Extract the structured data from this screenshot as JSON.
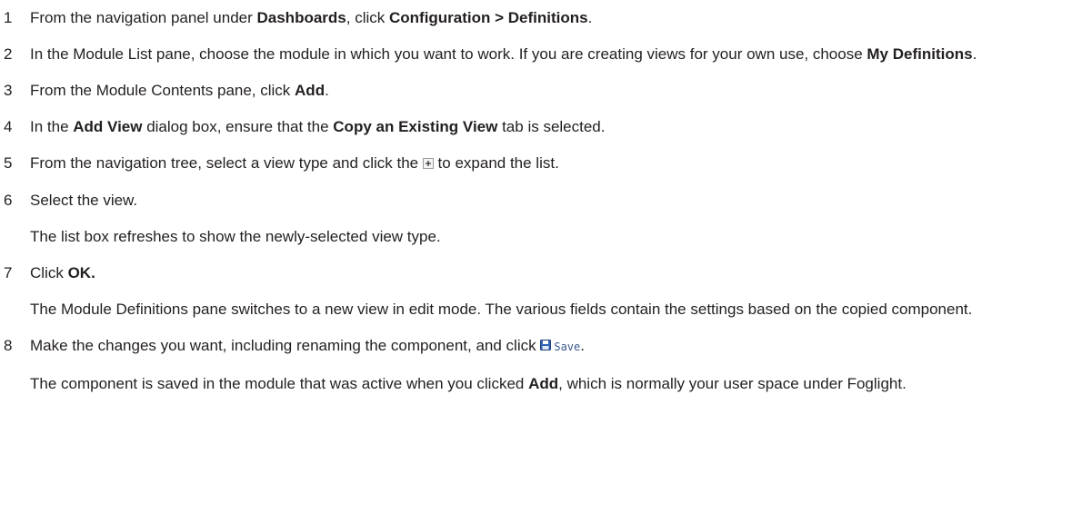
{
  "steps": [
    {
      "num": "1",
      "parts": [
        {
          "t": "From the navigation panel under "
        },
        {
          "t": "Dashboards",
          "b": true
        },
        {
          "t": ", click "
        },
        {
          "t": "Configuration > Definitions",
          "b": true
        },
        {
          "t": "."
        }
      ]
    },
    {
      "num": "2",
      "parts": [
        {
          "t": "In the Module List pane, choose the module in which you want to work. If you are creating views for your own use, choose "
        },
        {
          "t": "My Definitions",
          "b": true
        },
        {
          "t": "."
        }
      ]
    },
    {
      "num": "3",
      "parts": [
        {
          "t": "From the Module Contents pane, click "
        },
        {
          "t": "Add",
          "b": true
        },
        {
          "t": "."
        }
      ]
    },
    {
      "num": "4",
      "parts": [
        {
          "t": "In the "
        },
        {
          "t": "Add View",
          "b": true
        },
        {
          "t": " dialog box, ensure that the "
        },
        {
          "t": "Copy an Existing View",
          "b": true
        },
        {
          "t": " tab is selected."
        }
      ]
    },
    {
      "num": "5",
      "parts": [
        {
          "t": "From the navigation tree, select a view type and click the "
        },
        {
          "icon": "expand-plus-icon"
        },
        {
          "t": " to expand the list."
        }
      ]
    },
    {
      "num": "6",
      "parts": [
        {
          "t": "Select the view."
        }
      ],
      "note": "The list box refreshes to show the newly-selected view type."
    },
    {
      "num": "7",
      "parts": [
        {
          "t": "Click "
        },
        {
          "t": "OK.",
          "b": true
        }
      ],
      "note": "The Module Definitions pane switches to a new view in edit mode. The various fields contain the settings based on the copied component."
    },
    {
      "num": "8",
      "parts": [
        {
          "t": "Make the changes you want, including renaming the component, and click "
        },
        {
          "save": "Save"
        },
        {
          "t": "."
        }
      ],
      "note_parts": [
        {
          "t": "The component is saved in the module that was active when you clicked "
        },
        {
          "t": "Add",
          "b": true
        },
        {
          "t": ", which is normally your user space under Foglight."
        }
      ]
    }
  ],
  "colors": {
    "text": "#231f20",
    "save_text": "#3a5a8c",
    "floppy_blue": "#2f63b8",
    "icon_border": "#9a9a9a"
  }
}
